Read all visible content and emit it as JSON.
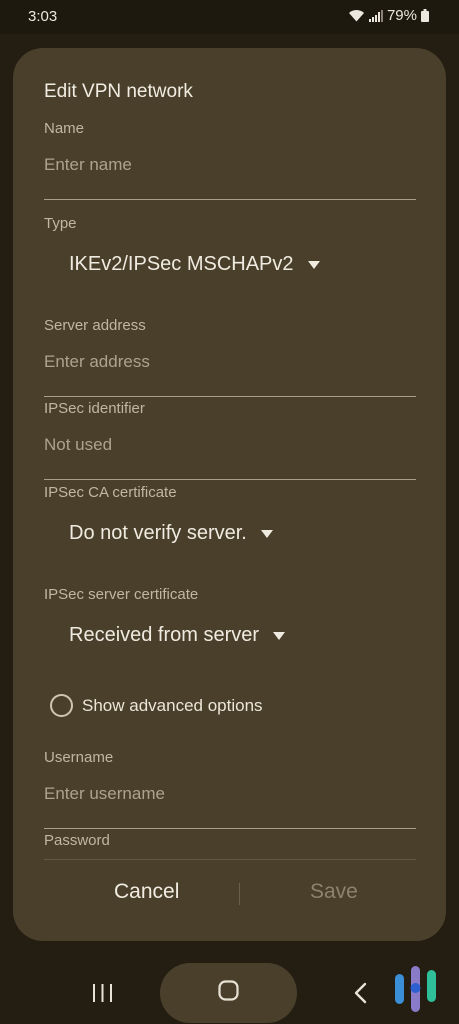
{
  "status_bar": {
    "time": "3:03",
    "battery": "79%"
  },
  "dialog": {
    "title": "Edit VPN network",
    "name": {
      "label": "Name",
      "placeholder": "Enter name"
    },
    "type": {
      "label": "Type",
      "value": "IKEv2/IPSec MSCHAPv2"
    },
    "server_address": {
      "label": "Server address",
      "placeholder": "Enter address"
    },
    "ipsec_identifier": {
      "label": "IPSec identifier",
      "placeholder": "Not used"
    },
    "ipsec_ca_certificate": {
      "label": "IPSec CA certificate",
      "value": "Do not verify server."
    },
    "ipsec_server_certificate": {
      "label": "IPSec server certificate",
      "value": "Received from server"
    },
    "advanced": {
      "label": "Show advanced options",
      "checked": false
    },
    "username": {
      "label": "Username",
      "placeholder": "Enter username"
    },
    "password": {
      "label": "Password"
    },
    "cancel_label": "Cancel",
    "save_label": "Save"
  },
  "nav_bar": {
    "recents_icon": "recents-icon",
    "home_icon": "home-icon",
    "back_icon": "back-icon"
  },
  "colors": {
    "background": "#231d12",
    "dialog": "#4a3f2b",
    "text": "#ece6d8",
    "disabled": "#8c836f",
    "logo_blue": "#3a8fd6",
    "logo_green": "#2fc09a"
  }
}
